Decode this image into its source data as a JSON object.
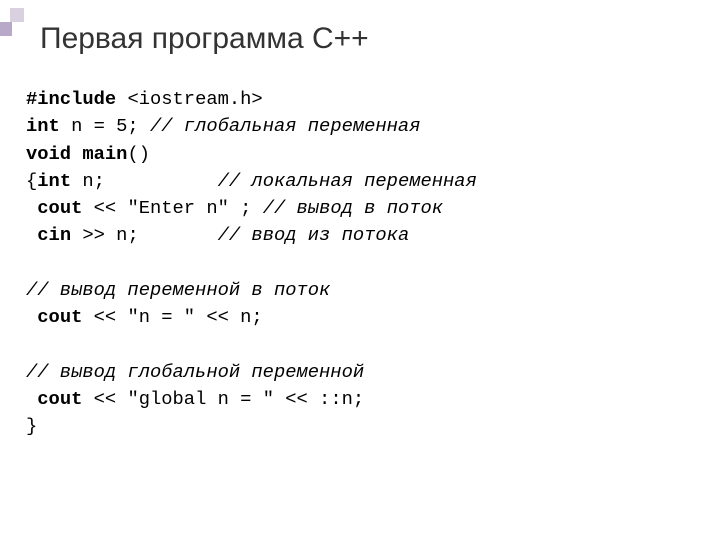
{
  "title": "Первая программа С++",
  "code": {
    "l1_kw": "#include",
    "l1_rest": " <iostream.h>",
    "l2_kw": "int",
    "l2_mid": " n = 5; ",
    "l2_cm": "// глобальная переменная",
    "l3_kw": "void main",
    "l3_rest": "()",
    "l4_a": "{",
    "l4_kw": "int",
    "l4_mid": " n;          ",
    "l4_cm": "// локальная переменная",
    "l5_pre": " ",
    "l5_kw": "cout",
    "l5_mid": " << \"Enter n\" ; ",
    "l5_cm": "// вывод в поток",
    "l6_pre": " ",
    "l6_kw": "cin",
    "l6_mid": " >> n;       ",
    "l6_cm": "// ввод из потока",
    "l7": "",
    "l8_cm": "// вывод переменной в поток",
    "l9_pre": " ",
    "l9_kw": "cout",
    "l9_rest": " << \"n = \" << n;",
    "l10": "",
    "l11_cm": "// вывод глобальной переменной",
    "l12_pre": " ",
    "l12_kw": "cout",
    "l12_rest": " << \"global n = \" << ::n;",
    "l13": "}"
  }
}
